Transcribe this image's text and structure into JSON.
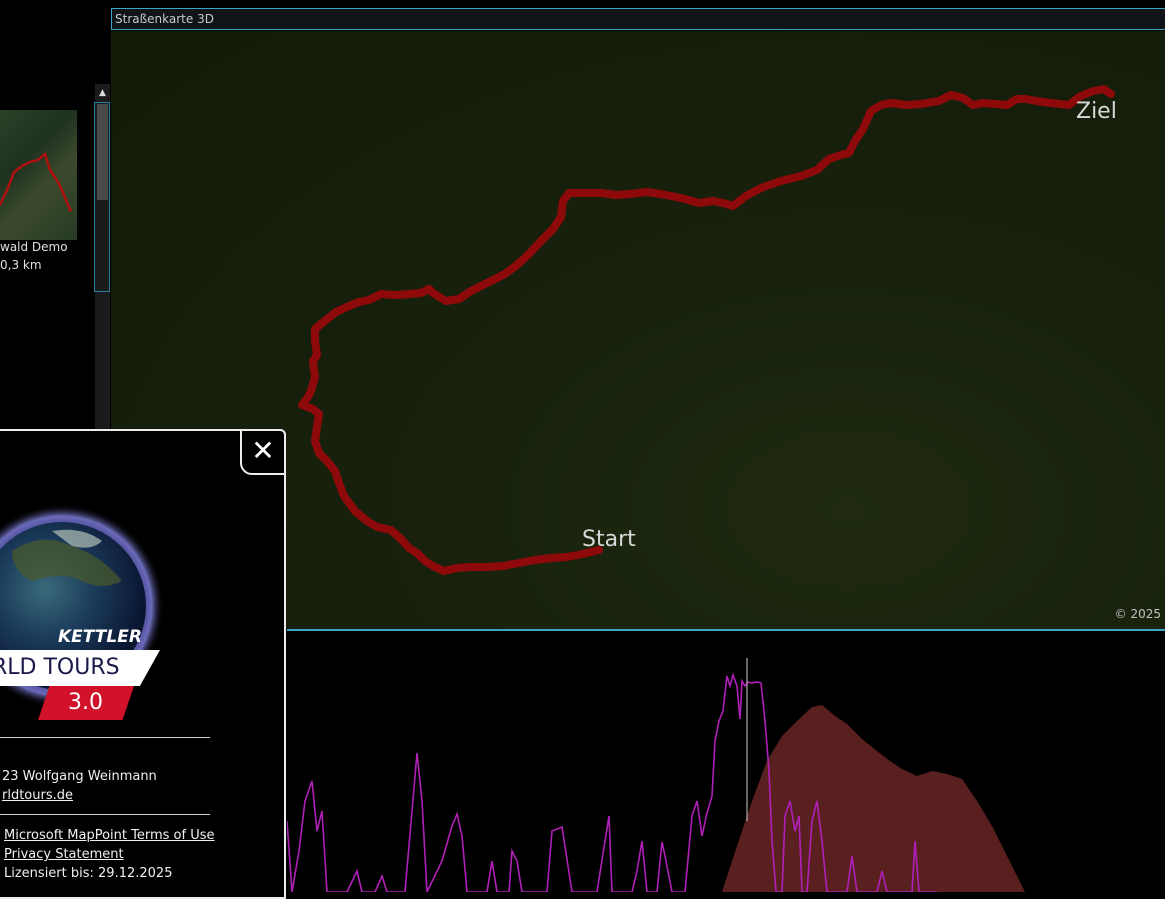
{
  "map": {
    "title": "Straßenkarte 3D",
    "start_label": "Start",
    "end_label": "Ziel",
    "copyright": "© 2025",
    "route_color": "#8e0a0a"
  },
  "tour_list": {
    "item_name": "wald Demo",
    "item_length": "0,3 km"
  },
  "about": {
    "close_glyph": "✕",
    "brand": "KETTLER",
    "product": "RLD TOURS",
    "version": "3.0",
    "copyright_line": "23 Wolfgang Weinmann",
    "website": "rldtours.de",
    "terms_link": "Microsoft MapPoint Terms of Use",
    "privacy_link": "Privacy Statement",
    "license_label": "Lizensiert bis:",
    "license_date": "29.12.2025"
  },
  "colors": {
    "accent": "#3aa7c9",
    "route": "#8e0a0a",
    "power_line": "#b01fb8",
    "elevation_fill": "#5a2020",
    "version_red": "#d1122a"
  }
}
